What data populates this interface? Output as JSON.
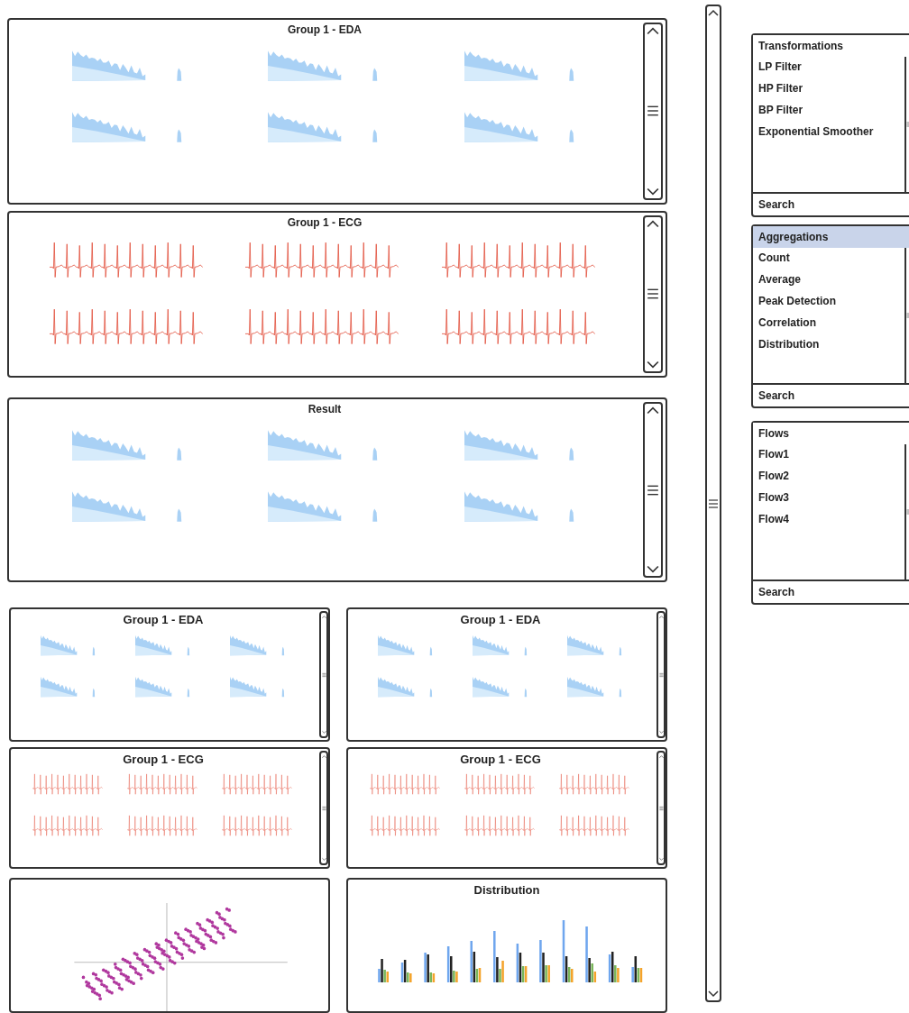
{
  "main_panels": [
    {
      "title": "Group 1 - EDA",
      "kind": "eda"
    },
    {
      "title": "Group 1 - ECG",
      "kind": "ecg"
    },
    {
      "title": "Result",
      "kind": "eda"
    }
  ],
  "small_panels": [
    {
      "title": "Group 1 - EDA",
      "kind": "eda"
    },
    {
      "title": "Group 1 - EDA",
      "kind": "eda"
    },
    {
      "title": "Group 1 - ECG",
      "kind": "ecg"
    },
    {
      "title": "Group 1 - ECG",
      "kind": "ecg"
    },
    {
      "kind": "scatter"
    },
    {
      "title": "Distribution",
      "kind": "distribution"
    }
  ],
  "tool_sections": [
    {
      "title": "Transformations",
      "selected": false,
      "items": [
        "LP Filter",
        "HP Filter",
        "BP Filter",
        "Exponential Smoother"
      ],
      "search": {
        "placeholder": "Search"
      }
    },
    {
      "title": "Aggregations",
      "selected": true,
      "items": [
        "Count",
        "Average",
        "Peak Detection",
        "Correlation",
        "Distribution"
      ],
      "search": {
        "placeholder": "Search"
      }
    },
    {
      "title": "Flows",
      "selected": false,
      "items": [
        "Flow1",
        "Flow2",
        "Flow3",
        "Flow4"
      ],
      "search": {
        "placeholder": "Search"
      }
    }
  ]
}
